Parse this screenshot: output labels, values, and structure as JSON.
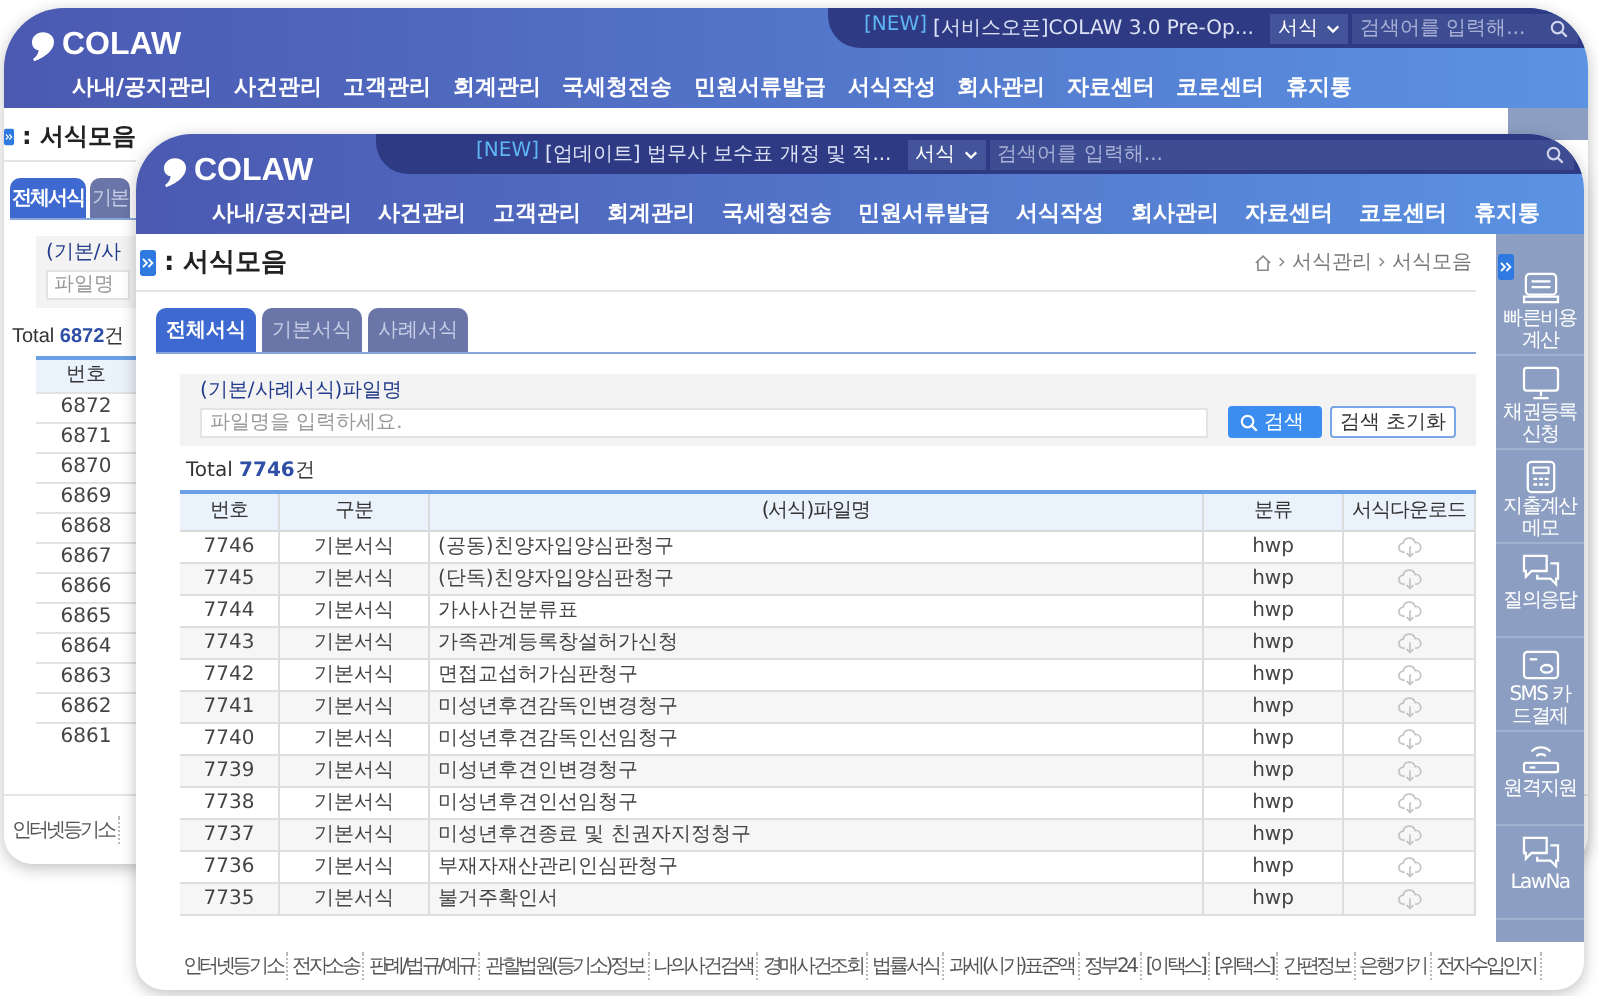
{
  "back_window": {
    "header": {
      "logo": "COLAW",
      "nav": [
        "사내/공지관리",
        "사건관리",
        "고객관리",
        "회계관리",
        "국세청전송",
        "민원서류발급",
        "서식작성",
        "회사관리",
        "자료센터",
        "코로센터",
        "휴지통"
      ],
      "notice": {
        "tag": "[NEW]",
        "text": "[서비스오픈]COLAW 3.0 Pre-Op..."
      },
      "search": {
        "scope": "서식",
        "placeholder": "검색어를 입력해..."
      }
    },
    "page_title": ": 서식모음",
    "tabs": [
      {
        "label": "전체서식",
        "selected": true
      },
      {
        "label": "기본",
        "selected": false
      }
    ],
    "filter": {
      "label": "(기본/사",
      "placeholder": "파일명"
    },
    "total": "Total **6872**건",
    "table": {
      "columns": [
        "번호"
      ],
      "rows": [
        [
          "6872"
        ],
        [
          "6871"
        ],
        [
          "6870"
        ],
        [
          "6869"
        ],
        [
          "6868"
        ],
        [
          "6867"
        ],
        [
          "6866"
        ],
        [
          "6865"
        ],
        [
          "6864"
        ],
        [
          "6863"
        ],
        [
          "6862"
        ],
        [
          "6861"
        ]
      ]
    },
    "footer_links": [
      "인터넷등기소"
    ]
  },
  "window": {
    "header": {
      "logo": "COLAW",
      "nav": [
        "사내/공지관리",
        "사건관리",
        "고객관리",
        "회계관리",
        "국세청전송",
        "민원서류발급",
        "서식작성",
        "회사관리",
        "자료센터",
        "코로센터",
        "휴지통"
      ],
      "notice": {
        "tag": "[NEW]",
        "text": "[업데이트] 법무사 보수표 개정 및 적..."
      },
      "search": {
        "scope": "서식",
        "placeholder": "검색어를 입력해..."
      }
    },
    "page_title": ": 서식모음",
    "breadcrumb": [
      "서식관리",
      "서식모음"
    ],
    "tabs": [
      {
        "label": "전체서식",
        "selected": true
      },
      {
        "label": "기본서식",
        "selected": false
      },
      {
        "label": "사례서식",
        "selected": false
      }
    ],
    "filter": {
      "label": "(기본/사례서식)파일명",
      "placeholder": "파일명을 입력하세요.",
      "buttons": [
        {
          "kind": "search",
          "label": "검색"
        },
        {
          "kind": "reset",
          "label": "검색 초기화"
        }
      ]
    },
    "total": "Total **7746**건",
    "table": {
      "columns": [
        "번호",
        "구분",
        "(서식)파일명",
        "분류",
        "서식다운로드"
      ],
      "rows": [
        {
          "no": "7746",
          "type": "기본서식",
          "name": "(공동)친양자입양심판청구",
          "format": "hwp"
        },
        {
          "no": "7745",
          "type": "기본서식",
          "name": "(단독)친양자입양심판청구",
          "format": "hwp"
        },
        {
          "no": "7744",
          "type": "기본서식",
          "name": "가사사건분류표",
          "format": "hwp"
        },
        {
          "no": "7743",
          "type": "기본서식",
          "name": "가족관계등록창설허가신청",
          "format": "hwp"
        },
        {
          "no": "7742",
          "type": "기본서식",
          "name": "면접교섭허가심판청구",
          "format": "hwp"
        },
        {
          "no": "7741",
          "type": "기본서식",
          "name": "미성년후견감독인변경청구",
          "format": "hwp"
        },
        {
          "no": "7740",
          "type": "기본서식",
          "name": "미성년후견감독인선임청구",
          "format": "hwp"
        },
        {
          "no": "7739",
          "type": "기본서식",
          "name": "미성년후견인변경청구",
          "format": "hwp"
        },
        {
          "no": "7738",
          "type": "기본서식",
          "name": "미성년후견인선임청구",
          "format": "hwp"
        },
        {
          "no": "7737",
          "type": "기본서식",
          "name": "미성년후견종료 및 친권자지정청구",
          "format": "hwp"
        },
        {
          "no": "7736",
          "type": "기본서식",
          "name": "부재자재산관리인심판청구",
          "format": "hwp"
        },
        {
          "no": "7735",
          "type": "기본서식",
          "name": "불거주확인서",
          "format": "hwp"
        }
      ]
    },
    "sidebar": {
      "items": [
        {
          "kind": "register",
          "label": "빠른비용 계산"
        },
        {
          "kind": "monitor",
          "label": "채권등록 신청"
        },
        {
          "kind": "calculator",
          "label": "지출계산 메모"
        },
        {
          "kind": "chat",
          "label": "질의응답"
        },
        {
          "kind": "card",
          "label": "SMS 카드결제"
        },
        {
          "kind": "router",
          "label": "원격지원"
        },
        {
          "kind": "chat",
          "label": "LawNa"
        }
      ]
    },
    "footer_links": [
      "인터넷등기소",
      "전자소송",
      "판례/법규/예규",
      "관할법원(등기소)정보",
      "나의사건검색",
      "경매사건조회",
      "법률서식",
      "과세(시가)표준액",
      "정부24",
      "[이택스]",
      "[위택스]",
      "간편정보",
      "은행가기",
      "전자수입인지"
    ]
  }
}
